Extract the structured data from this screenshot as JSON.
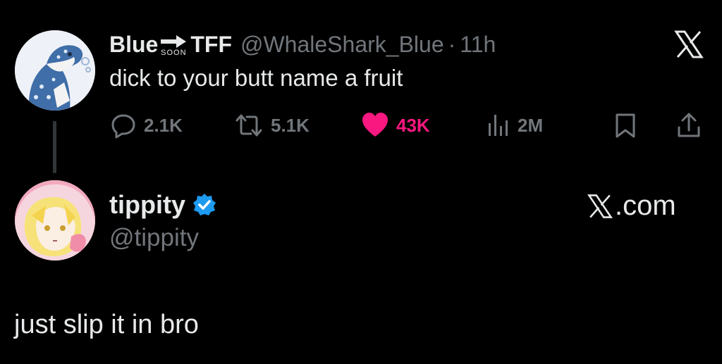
{
  "tweet": {
    "author_name_left": "Blue",
    "author_name_soon": "SOON",
    "author_name_right": "TFF",
    "handle": "@WhaleShark_Blue",
    "separator": "·",
    "time": "11h",
    "text": "dick to your butt name a fruit",
    "actions": {
      "replies": "2.1K",
      "reposts": "5.1K",
      "likes": "43K",
      "views": "2M"
    }
  },
  "reply_user": {
    "name": "tippity",
    "handle": "@tippity",
    "verified": true,
    "site": ".com"
  },
  "reply": {
    "text": "just slip it in bro"
  },
  "colors": {
    "background": "#000000",
    "text": "#e7e9ea",
    "muted": "#71767b",
    "like": "#f91880",
    "verified": "#1d9bf0"
  },
  "icons": [
    "close-x-icon",
    "reply-icon",
    "repost-icon",
    "heart-icon",
    "views-icon",
    "bookmark-icon",
    "share-icon",
    "verified-badge-icon",
    "x-logo-icon"
  ]
}
